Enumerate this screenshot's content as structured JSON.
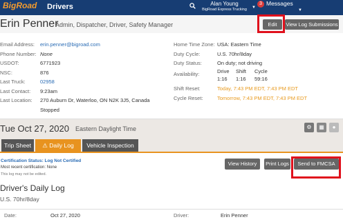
{
  "topbar": {
    "logo": "BigRoad",
    "app_title": "Drivers",
    "user_name": "Alan Young",
    "user_company": "BigRoad Express Trucking",
    "message_count": "3",
    "messages_label": "Messages"
  },
  "profile": {
    "name": "Erin Penner",
    "roles": "Admin, Dispatcher, Driver, Safety Manager",
    "edit_label": "Edit",
    "log_submissions_label": "View Log Submissions"
  },
  "details_left": [
    {
      "label": "Email Address:",
      "value": "erin.penner@bigroad.com"
    },
    {
      "label": "Phone Number:",
      "value": "None"
    },
    {
      "label": "USDOT:",
      "value": "6771923"
    },
    {
      "label": "NSC:",
      "value": "876"
    },
    {
      "label": "Last Truck:",
      "value": "02958"
    },
    {
      "label": "Last Contact:",
      "value": "9:23am"
    },
    {
      "label": "Last Location:",
      "value": "270 Auburn Dr, Waterloo, ON N2K 3J5, Canada",
      "value2": "Stopped"
    }
  ],
  "details_right": {
    "home_tz_label": "Home Time Zone:",
    "home_tz": "USA: Eastern Time",
    "cycle_label": "Duty Cycle:",
    "cycle": "U.S. 70hr/8day",
    "status_label": "Duty Status:",
    "status": "On duty; not driving",
    "availability_label": "Availability:",
    "avail_headers": [
      "Drive",
      "Shift",
      "Cycle"
    ],
    "avail_values": [
      "1:16",
      "1:16",
      "59:16"
    ],
    "shift_reset_label": "Shift Reset:",
    "shift_reset": "Today, 7:43 PM EDT, 7:43 PM EDT",
    "cycle_reset_label": "Cycle Reset:",
    "cycle_reset": "Tomorrow, 7:43 PM EDT, 7:43 PM EDT"
  },
  "log_header": {
    "date": "Tue Oct 27, 2020",
    "timezone": "Eastern Daylight Time"
  },
  "tabs": [
    {
      "label": "Trip Sheet"
    },
    {
      "label": "⚠ Daily Log"
    },
    {
      "label": "Vehicle Inspection"
    }
  ],
  "certification": {
    "status": "Certification Status: Log Not Certified",
    "recent": "Most recent certification: None",
    "note": "This log may not be edited."
  },
  "actions": {
    "view_history": "View History",
    "print_logs": "Print Logs",
    "send_fmcsa": "Send to FMCSA"
  },
  "daily_log": {
    "title": "Driver's Daily Log",
    "cycle": "U.S. 70hr/8day",
    "date_label": "Date:",
    "date": "Oct 27, 2020",
    "driver_label": "Driver:",
    "driver": "Erin Penner"
  }
}
